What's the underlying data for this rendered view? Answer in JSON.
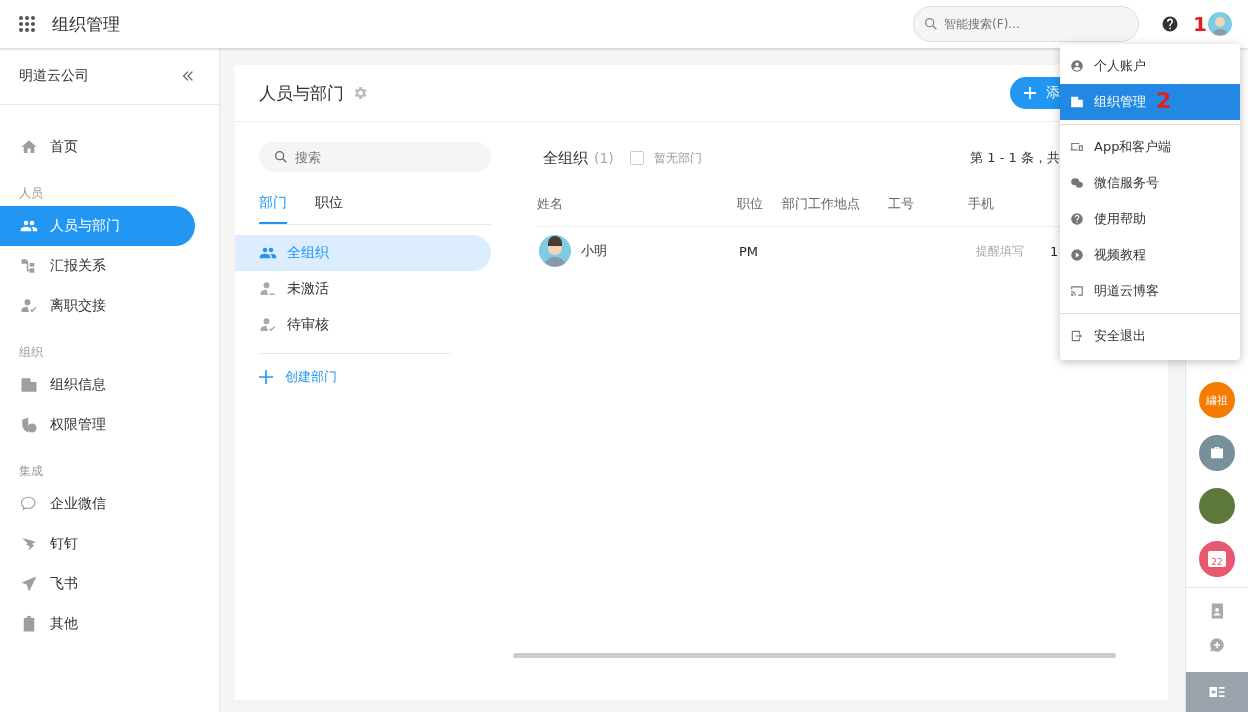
{
  "topbar": {
    "title": "组织管理",
    "search": {
      "placeholder": "智能搜索(F)..."
    },
    "annotation": "1"
  },
  "sidebar": {
    "company": "明道云公司",
    "sections": [
      {
        "items": [
          {
            "label": "首页",
            "selected": false
          }
        ]
      },
      {
        "heading": "人员",
        "items": [
          {
            "label": "人员与部门",
            "selected": true
          },
          {
            "label": "汇报关系",
            "selected": false
          },
          {
            "label": "离职交接",
            "selected": false
          }
        ]
      },
      {
        "heading": "组织",
        "items": [
          {
            "label": "组织信息",
            "selected": false
          },
          {
            "label": "权限管理",
            "selected": false
          }
        ]
      },
      {
        "heading": "集成",
        "items": [
          {
            "label": "企业微信",
            "selected": false
          },
          {
            "label": "钉钉",
            "selected": false
          },
          {
            "label": "飞书",
            "selected": false
          },
          {
            "label": "其他",
            "selected": false
          }
        ]
      }
    ]
  },
  "card": {
    "title": "人员与部门",
    "add_button": "添",
    "dept_panel": {
      "search": {
        "placeholder": "搜索"
      },
      "tabs": [
        {
          "label": "部门",
          "selected": true
        },
        {
          "label": "职位",
          "selected": false
        }
      ],
      "items": [
        {
          "label": "全组织",
          "selected": true
        },
        {
          "label": "未激活",
          "selected": false
        },
        {
          "label": "待审核",
          "selected": false
        }
      ],
      "create": "创建部门"
    },
    "list": {
      "title": "全组织",
      "count": "(1)",
      "no_dept": {
        "label": "暂无部门",
        "checked": false
      },
      "pagination": "第 1 - 1 条，共",
      "columns": [
        "姓名",
        "职位",
        "部门工作地点",
        "工号",
        "手机"
      ],
      "rows": [
        {
          "name": "小明",
          "position": "PM",
          "phone": "提醒填写",
          "email": "1"
        }
      ]
    }
  },
  "user_menu": {
    "annotation": "2",
    "groups": [
      [
        {
          "label": "个人账户",
          "selected": false
        },
        {
          "label": "组织管理",
          "selected": true
        }
      ],
      [
        {
          "label": "App和客户端",
          "selected": false
        },
        {
          "label": "微信服务号",
          "selected": false
        },
        {
          "label": "使用帮助",
          "selected": false
        },
        {
          "label": "视频教程",
          "selected": false
        },
        {
          "label": "明道云博客",
          "selected": false
        }
      ],
      [
        {
          "label": "安全退出",
          "selected": false
        }
      ]
    ]
  },
  "right_rail": {
    "apps": [
      {
        "kind": "text",
        "label": "繍祖",
        "color": "#f57c00"
      },
      {
        "kind": "briefcase",
        "color": "#78909c"
      },
      {
        "kind": "photo",
        "color": "#5d7a3a"
      },
      {
        "kind": "calendar",
        "label": "22",
        "color": "#e8586e"
      }
    ]
  }
}
